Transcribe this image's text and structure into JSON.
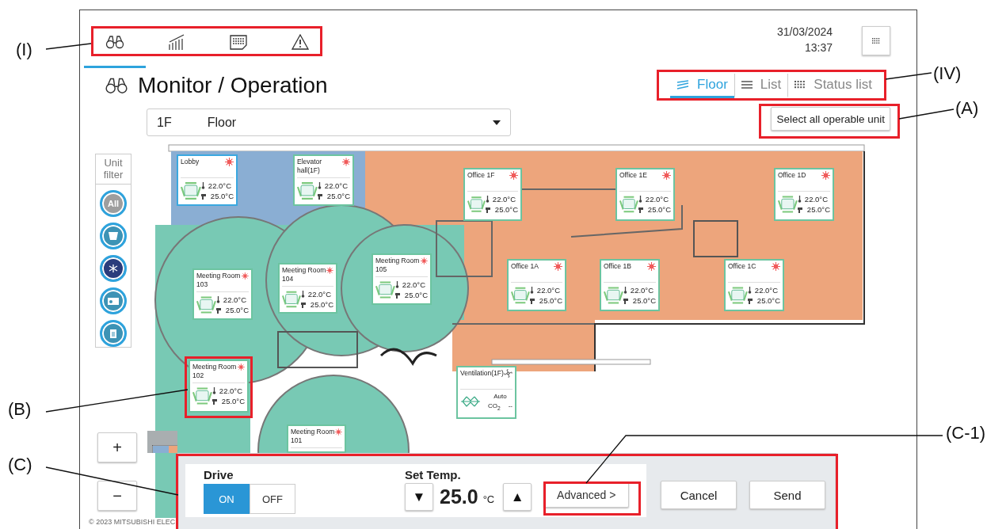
{
  "nav_tabs": [
    {
      "kind": "monitor",
      "selected": true
    },
    {
      "kind": "trend",
      "selected": false
    },
    {
      "kind": "schedule",
      "selected": false
    },
    {
      "kind": "alarm",
      "selected": false
    }
  ],
  "date": "31/03/2024",
  "time": "13:37",
  "page_title": "Monitor / Operation",
  "view_tabs": [
    {
      "kind": "floor",
      "label": "Floor",
      "selected": true
    },
    {
      "kind": "list",
      "label": "List",
      "selected": false
    },
    {
      "kind": "status",
      "label": "Status list",
      "selected": false
    }
  ],
  "floor_select": {
    "code": "1F",
    "name": "Floor"
  },
  "select_all_button": "Select all operable unit",
  "unit_filter": {
    "title": "Unit filter",
    "items": [
      {
        "kind": "all",
        "label": "All",
        "color": "#9e9e9e"
      },
      {
        "kind": "indoor",
        "color": "#3d93b5"
      },
      {
        "kind": "ventilation",
        "color": "#2a3c7c"
      },
      {
        "kind": "outdoor",
        "color": "#3d93b5"
      },
      {
        "kind": "other",
        "color": "#3d93b5"
      }
    ]
  },
  "units": [
    {
      "kind": "ac",
      "name": "Lobby",
      "heating": true,
      "room_temp": "22.0°C",
      "set_temp": "25.0°C",
      "selected": true
    },
    {
      "kind": "ac",
      "name": "Elevator hall(1F)",
      "heating": true,
      "room_temp": "22.0°C",
      "set_temp": "25.0°C",
      "selected": false
    },
    {
      "kind": "ac",
      "name": "Office 1F",
      "heating": true,
      "room_temp": "22.0°C",
      "set_temp": "25.0°C",
      "selected": false
    },
    {
      "kind": "ac",
      "name": "Office 1E",
      "heating": true,
      "room_temp": "22.0°C",
      "set_temp": "25.0°C",
      "selected": false
    },
    {
      "kind": "ac",
      "name": "Office 1D",
      "heating": true,
      "room_temp": "22.0°C",
      "set_temp": "25.0°C",
      "selected": false
    },
    {
      "kind": "ac",
      "name": "Meeting Room 105",
      "heating": true,
      "room_temp": "22.0°C",
      "set_temp": "25.0°C",
      "selected": false
    },
    {
      "kind": "ac",
      "name": "Meeting Room 104",
      "heating": true,
      "room_temp": "22.0°C",
      "set_temp": "25.0°C",
      "selected": false
    },
    {
      "kind": "ac",
      "name": "Meeting Room 103",
      "heating": true,
      "room_temp": "22.0°C",
      "set_temp": "25.0°C",
      "selected": false
    },
    {
      "kind": "ac",
      "name": "Office 1A",
      "heating": true,
      "room_temp": "22.0°C",
      "set_temp": "25.0°C",
      "selected": false
    },
    {
      "kind": "ac",
      "name": "Office 1B",
      "heating": true,
      "room_temp": "22.0°C",
      "set_temp": "25.0°C",
      "selected": false
    },
    {
      "kind": "ac",
      "name": "Office 1C",
      "heating": true,
      "room_temp": "22.0°C",
      "set_temp": "25.0°C",
      "selected": false
    },
    {
      "kind": "ac",
      "name": "Meeting Room 102",
      "heating": true,
      "room_temp": "22.0°C",
      "set_temp": "25.0°C",
      "selected": false
    },
    {
      "kind": "vent",
      "name": "Ventilation(1F)",
      "heating": false,
      "status": "Auto",
      "sensor": "CO$_{2}$",
      "reading": "--",
      "selected": false
    },
    {
      "kind": "ac",
      "name": "Meeting Room 101",
      "heating": true,
      "selected": false
    }
  ],
  "zoom_buttons": [
    "+",
    "−"
  ],
  "copyright": "© 2023 MITSUBISHI ELEC",
  "control_panel": {
    "drive": {
      "label": "Drive",
      "options": [
        {
          "label": "ON",
          "selected": true
        },
        {
          "label": "OFF",
          "selected": false
        }
      ]
    },
    "set_temp": {
      "label": "Set Temp.",
      "down": "▼",
      "value": "25.0",
      "unit": "°C",
      "up": "▲"
    },
    "advanced_button": "Advanced >",
    "buttons": [
      "Cancel",
      "Send"
    ]
  },
  "annotations": [
    {
      "label": "(I)"
    },
    {
      "label": "(IV)"
    },
    {
      "label": "(A)"
    },
    {
      "label": "(B)"
    },
    {
      "label": "(C)"
    },
    {
      "label": "(C-1)"
    }
  ]
}
